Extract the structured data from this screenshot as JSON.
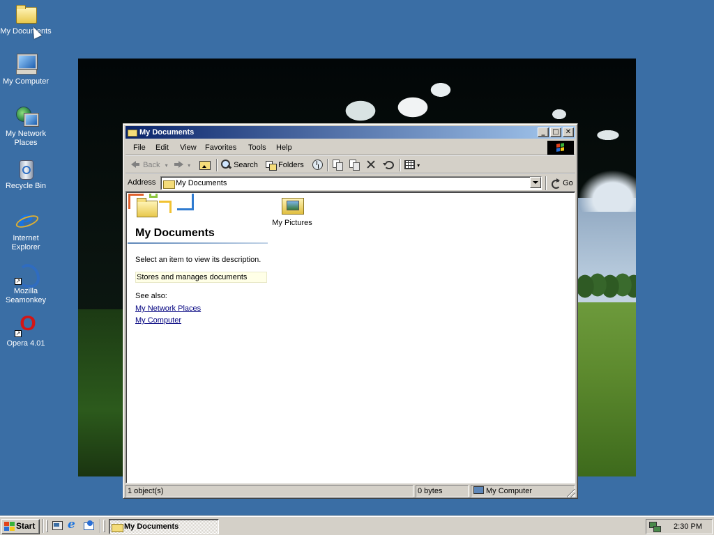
{
  "desktop": {
    "background_color": "#3a6ea5",
    "icons": [
      {
        "label": "My Documents",
        "icon": "my-documents-icon"
      },
      {
        "label": "My Computer",
        "icon": "my-computer-icon"
      },
      {
        "label": "My Network Places",
        "icon": "network-places-icon"
      },
      {
        "label": "Recycle Bin",
        "icon": "recycle-bin-icon"
      },
      {
        "label": "Internet Explorer",
        "icon": "internet-explorer-icon"
      },
      {
        "label": "Mozilla Seamonkey",
        "icon": "mozilla-seamonkey-icon"
      },
      {
        "label": "Opera 4.01",
        "icon": "opera-icon"
      }
    ]
  },
  "window": {
    "title": "My Documents",
    "title_buttons": {
      "minimize": "_",
      "maximize": "□",
      "close": "✕"
    },
    "menu": [
      "File",
      "Edit",
      "View",
      "Favorites",
      "Tools",
      "Help"
    ],
    "toolbar": {
      "back": "Back",
      "search": "Search",
      "folders": "Folders"
    },
    "address": {
      "label": "Address",
      "value": "My Documents",
      "go": "Go"
    },
    "info_pane": {
      "title": "My Documents",
      "description": "Select an item to view its description.",
      "info": "Stores and manages documents",
      "see_also": "See also:",
      "links": [
        "My Network Places",
        "My Computer"
      ]
    },
    "items": [
      {
        "name": "My Pictures",
        "icon": "my-pictures-folder-icon"
      }
    ],
    "status": {
      "objects": "1 object(s)",
      "size": "0 bytes",
      "zone": "My Computer"
    }
  },
  "taskbar": {
    "start": "Start",
    "tasks": [
      "My Documents"
    ],
    "clock": "2:30 PM"
  },
  "colors": {
    "titlebar_start": "#0a246a",
    "titlebar_end": "#a6caf0",
    "face": "#d4d0c8",
    "link": "#00007f"
  }
}
